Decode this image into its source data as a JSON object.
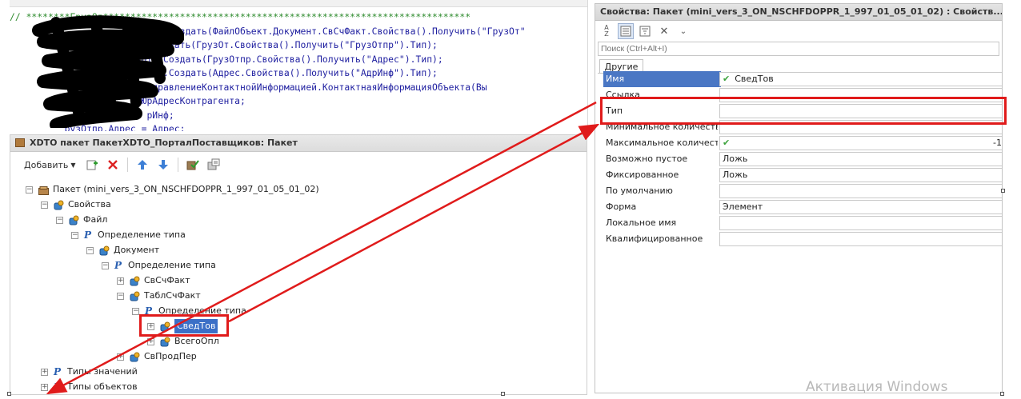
{
  "code_editor": {
    "lines": [
      {
        "segments": [
          {
            "t": "// ********ГрузОт*******************************************************************",
            "c": "comment"
          }
        ]
      },
      {
        "segments": [
          {
            "t": "                             Создать(ФайлОбъект.Документ.СвСчФакт.Свойства().Получить(\"ГрузОт\"",
            "c": "text"
          }
        ]
      },
      {
        "segments": [
          {
            "t": "                  икаXDTO.Создать(ГрузОт.Свойства().Получить(\"ГрузОтпр\").Тип);",
            "c": "text"
          }
        ]
      },
      {
        "segments": [
          {
            "t": "                     кaXDTO.Создать(ГрузОтпр.Свойства().Получить(\"Адрес\").Тип);",
            "c": "text"
          }
        ]
      },
      {
        "segments": [
          {
            "t": "                  абрикаXDTO.Создать(Адрес.Свойства().Получить(\"АдрИнф\").Тип);",
            "c": "text"
          }
        ]
      },
      {
        "segments": [
          {
            "t": "              трагента = УправлениеКонтактнойИнформацией.КонтактнаяИнформацияОбъекта(Вы",
            "c": "text"
          }
        ]
      },
      {
        "segments": [
          {
            "t": "          А             ЮрАдресКонтрагента;",
            "c": "text"
          }
        ]
      },
      {
        "segments": [
          {
            "t": "             дрИнф       рИнф;",
            "c": "text"
          }
        ]
      },
      {
        "segments": [
          {
            "t": "          рузОтпр.Адрес = Адрес;",
            "c": "text"
          }
        ]
      }
    ]
  },
  "xdto_pane": {
    "title": "XDTO пакет ПакетXDTO_ПорталПоставщиков: Пакет",
    "toolbar": {
      "add_label": "Добавить"
    },
    "tree": [
      {
        "label": "Пакет (mini_vers_3_ON_NSCHFDOPPR_1_997_01_05_01_02)",
        "icon": "package-icon",
        "toggle": "⊖",
        "level": 0
      },
      {
        "label": "Свойства",
        "icon": "property-icon",
        "toggle": "⊖",
        "level": 1
      },
      {
        "label": "Файл",
        "icon": "property-icon",
        "toggle": "⊖",
        "level": 2
      },
      {
        "label": "Определение типа",
        "icon": "type-definition-icon",
        "toggle": "⊖",
        "level": 3
      },
      {
        "label": "Документ",
        "icon": "property-icon",
        "toggle": "⊖",
        "level": 4
      },
      {
        "label": "Определение типа",
        "icon": "type-definition-icon",
        "toggle": "⊖",
        "level": 5
      },
      {
        "label": "СвСчФакт",
        "icon": "property-icon",
        "toggle": "⊕",
        "level": 6
      },
      {
        "label": "ТаблСчФакт",
        "icon": "property-icon",
        "toggle": "⊖",
        "level": 6
      },
      {
        "label": "Определение типа",
        "icon": "type-definition-icon",
        "toggle": "⊖",
        "level": 7
      },
      {
        "label": "СведТов",
        "icon": "property-icon",
        "toggle": "⊕",
        "level": 8,
        "selected": true
      },
      {
        "label": "ВсегоОпл",
        "icon": "property-icon",
        "toggle": "⊕",
        "level": 8
      },
      {
        "label": "СвПродПер",
        "icon": "property-icon",
        "toggle": "⊕",
        "level": 6
      },
      {
        "label": "Типы значений",
        "icon": "type-definition-icon",
        "toggle": "⊕",
        "level": 1
      },
      {
        "label": "Типы объектов",
        "icon": "type-definition-icon",
        "toggle": "⊕",
        "level": 1
      }
    ]
  },
  "properties_pane": {
    "title": "Свойства: Пакет (mini_vers_3_ON_NSCHFDOPPR_1_997_01_05_01_02) : Свойств...",
    "search_placeholder": "Поиск (Ctrl+Alt+I)",
    "tab": "Другие",
    "rows": [
      {
        "name": "Имя",
        "value": "СведТов",
        "check": true,
        "highlight": true
      },
      {
        "name": "Ссылка",
        "value": ""
      },
      {
        "name": "Тип",
        "value": ""
      },
      {
        "name": "Минимальное количество",
        "value": ""
      },
      {
        "name": "Максимальное количество",
        "value": "-1",
        "check": true
      },
      {
        "name": "Возможно пустое",
        "value": "Ложь"
      },
      {
        "name": "Фиксированное",
        "value": "Ложь"
      },
      {
        "name": "По умолчанию",
        "value": ""
      },
      {
        "name": "Форма",
        "value": "Элемент"
      },
      {
        "name": "Локальное имя",
        "value": ""
      },
      {
        "name": "Квалифицированное",
        "value": ""
      }
    ]
  },
  "watermark": "Активация Windows",
  "colors": {
    "annotation": "#e01b1b",
    "selection": "#3b6fc7",
    "check": "#3aa23a"
  }
}
